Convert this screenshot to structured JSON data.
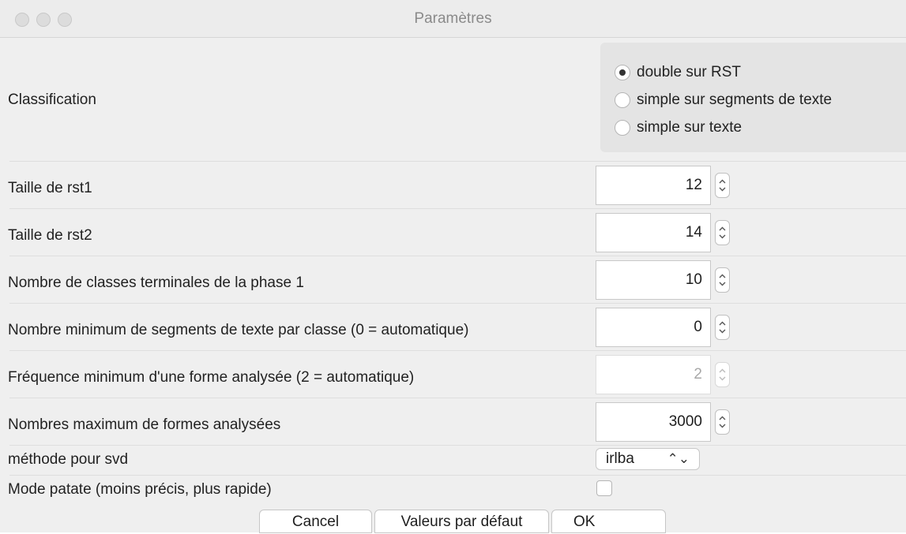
{
  "window": {
    "title": "Paramètres"
  },
  "classification": {
    "label": "Classification",
    "options": [
      {
        "label": "double sur RST",
        "selected": true
      },
      {
        "label": "simple sur segments de texte",
        "selected": false
      },
      {
        "label": "simple sur texte",
        "selected": false
      }
    ]
  },
  "fields": {
    "rst1": {
      "label": "Taille de rst1",
      "value": "12"
    },
    "rst2": {
      "label": "Taille de rst2",
      "value": "14"
    },
    "classes": {
      "label": "Nombre de classes terminales de la phase 1",
      "value": "10"
    },
    "min_segments": {
      "label": "Nombre minimum de segments de texte par classe (0 = automatique)",
      "value": "0"
    },
    "min_freq": {
      "label": "Fréquence minimum d'une forme analysée (2 = automatique)",
      "value": "2",
      "disabled": true
    },
    "max_forms": {
      "label": "Nombres maximum de formes analysées",
      "value": "3000"
    }
  },
  "svd": {
    "label": "méthode pour svd",
    "value": "irlba"
  },
  "patate": {
    "label": "Mode patate (moins précis, plus rapide)",
    "checked": false
  },
  "buttons": {
    "cancel": "Cancel",
    "defaults": "Valeurs par défaut",
    "ok": "OK"
  }
}
